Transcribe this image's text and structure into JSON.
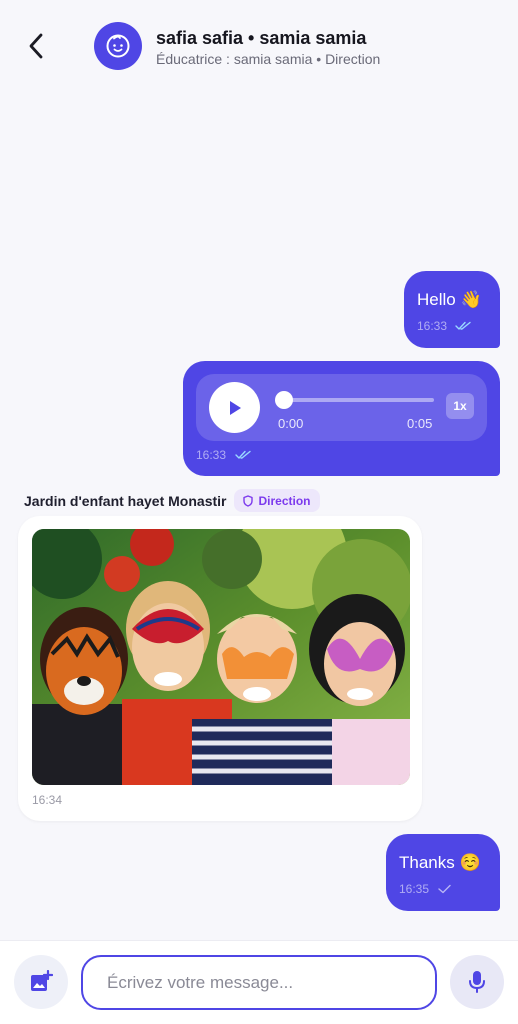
{
  "header": {
    "title": "safia safia • samia samia",
    "subtitle": "Éducatrice : samia samia • Direction",
    "back_icon": "chevron-left-icon",
    "avatar_icon": "baby-face-icon"
  },
  "messages": [
    {
      "type": "text",
      "direction": "outgoing",
      "text": "Hello 👋",
      "time": "16:33",
      "status_icon": "double-check-icon"
    },
    {
      "type": "voice",
      "direction": "outgoing",
      "current": "0:00",
      "duration": "0:05",
      "speed": "1x",
      "progress": 0,
      "time": "16:33",
      "status_icon": "double-check-icon"
    },
    {
      "type": "image",
      "direction": "incoming",
      "sender": "Jardin d'enfant hayet Monastir",
      "role": "Direction",
      "role_icon": "shield-icon",
      "image": "children-face-paint-photo",
      "time": "16:34"
    },
    {
      "type": "text",
      "direction": "outgoing",
      "text": "Thanks ☺️",
      "time": "16:35",
      "status_icon": "single-check-icon"
    }
  ],
  "composer": {
    "placeholder": "Écrivez votre message...",
    "attach_icon": "add-photo-icon",
    "mic_icon": "microphone-icon"
  },
  "colors": {
    "accent": "#4f46e5",
    "role_badge_bg": "#ede7fb",
    "role_badge_text": "#7c3aed",
    "background": "#f7f7fb"
  }
}
